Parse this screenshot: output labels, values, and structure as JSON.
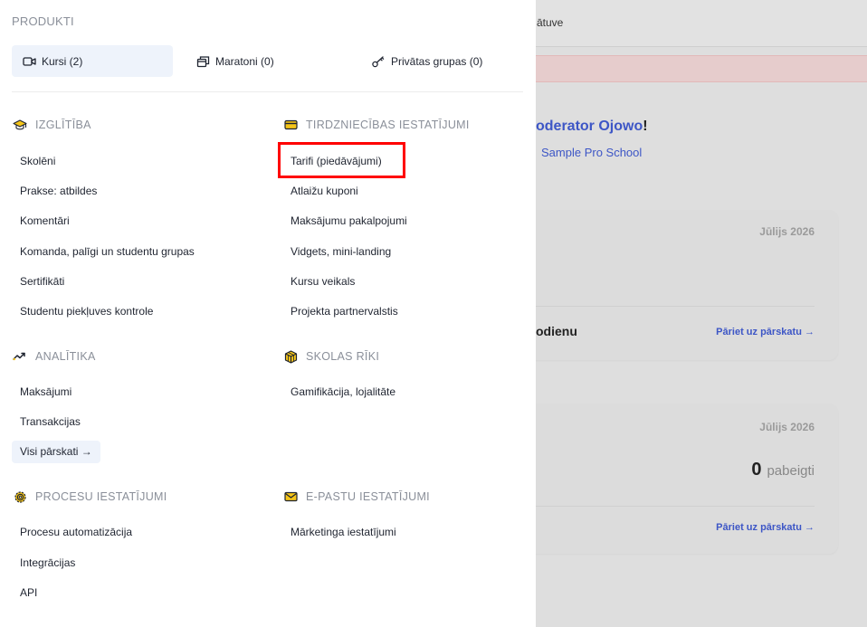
{
  "background": {
    "topbar_text": "ātuve",
    "greeting_name": "oderator Ojowo",
    "greeting_punct": "!",
    "school_name": "Sample Pro School",
    "card1": {
      "month": "Jūlijs 2026",
      "today_label": "odienu",
      "link": "Pāriet uz pārskatu →"
    },
    "card2": {
      "month": "Jūlijs 2026",
      "count": "0",
      "count_label": "pabeigti",
      "link": "Pāriet uz pārskatu →"
    }
  },
  "menu": {
    "products_label": "PRODUKTI",
    "products": [
      {
        "label": "Kursi (2)",
        "icon": "video-camera-icon",
        "active": true
      },
      {
        "label": "Maratoni (0)",
        "icon": "stack-windows-icon",
        "active": false
      },
      {
        "label": "Privātas grupas (0)",
        "icon": "key-icon",
        "active": false
      }
    ],
    "education": {
      "title": "IZGLĪTĪBA",
      "icon": "graduation-cap-icon",
      "items": [
        "Skolēni",
        "Prakse: atbildes",
        "Komentāri",
        "Komanda, palīgi un studentu grupas",
        "Sertifikāti",
        "Studentu piekļuves kontrole"
      ]
    },
    "sales": {
      "title": "TIRDZNIECĪBAS IESTATĪJUMI",
      "icon": "credit-card-icon",
      "items": [
        "Tarifi (piedāvājumi)",
        "Atlaižu kuponi",
        "Maksājumu pakalpojumi",
        "Vidgets, mini-landing",
        "Kursu veikals",
        "Projekta partnervalstis"
      ]
    },
    "analytics": {
      "title": "ANALĪTIKA",
      "icon": "trend-up-icon",
      "items": [
        "Maksājumi",
        "Transakcijas"
      ],
      "all_reports": "Visi pārskati →"
    },
    "school_tools": {
      "title": "SKOLAS RĪKI",
      "icon": "cube-icon",
      "items": [
        "Gamifikācija, lojalitāte"
      ]
    },
    "process": {
      "title": "PROCESU IESTATĪJUMI",
      "icon": "gear-icon",
      "items": [
        "Procesu automatizācija",
        "Integrācijas",
        "API"
      ]
    },
    "email": {
      "title": "E-PASTU IESTATĪJUMI",
      "icon": "envelope-icon",
      "items": [
        "Mārketinga iestatījumi"
      ]
    }
  },
  "colors": {
    "accent_yellow": "#f5c518",
    "highlight_red": "#ff0000",
    "link_blue": "#3d56c6"
  }
}
